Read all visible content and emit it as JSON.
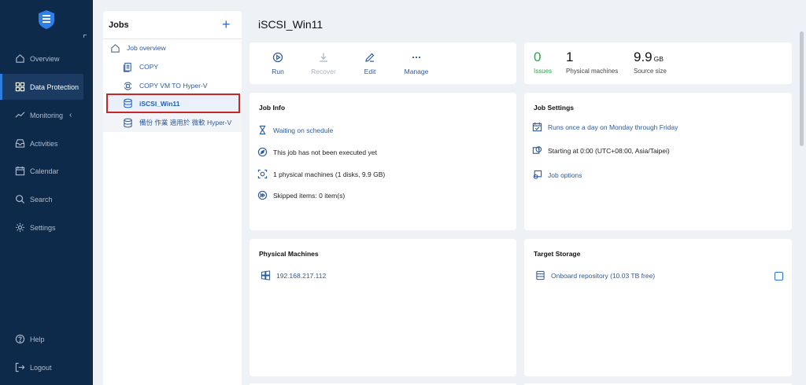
{
  "sidebar": {
    "items": [
      {
        "label": "Overview",
        "icon": "home-icon"
      },
      {
        "label": "Data Protection",
        "icon": "grid-icon",
        "active": true
      },
      {
        "label": "Monitoring",
        "icon": "chart-icon"
      },
      {
        "label": "Activities",
        "icon": "inbox-icon"
      },
      {
        "label": "Calendar",
        "icon": "calendar-icon"
      },
      {
        "label": "Search",
        "icon": "search-icon"
      },
      {
        "label": "Settings",
        "icon": "gear-icon"
      }
    ],
    "help": "Help",
    "logout": "Logout",
    "monitoring_chevron": "‹"
  },
  "jobs": {
    "title": "Jobs",
    "add_symbol": "+",
    "overview_label": "Job overview",
    "items": [
      {
        "label": "COPY"
      },
      {
        "label": "COPY VM TO Hyper-V"
      },
      {
        "label": "iSCSI_Win11",
        "selected": true
      },
      {
        "label": "備份 作業 適用於 微軟 Hyper-V"
      }
    ]
  },
  "main": {
    "title": "iSCSI_Win11",
    "actions": [
      {
        "label": "Run",
        "enabled": true
      },
      {
        "label": "Recover",
        "enabled": false
      },
      {
        "label": "Edit",
        "enabled": true
      },
      {
        "label": "Manage",
        "enabled": true
      }
    ],
    "stats": [
      {
        "value": "0",
        "unit": "",
        "label": "Issues",
        "color": "#22a846"
      },
      {
        "value": "1",
        "unit": "",
        "label": "Physical machines",
        "color": "#111111"
      },
      {
        "value": "9.9",
        "unit": "GB",
        "label": "Source size",
        "color": "#111111"
      }
    ],
    "job_info": {
      "title": "Job Info",
      "rows": [
        {
          "text": "Waiting on schedule",
          "icon": "hourglass-icon"
        },
        {
          "text": "This job has not been executed yet",
          "icon": "compass-icon"
        },
        {
          "text": "1 physical machines (1 disks, 9.9 GB)",
          "icon": "target-icon"
        },
        {
          "text": "Skipped items: 0 item(s)",
          "icon": "skip-icon"
        }
      ]
    },
    "job_settings": {
      "title": "Job Settings",
      "rows": [
        {
          "text": "Runs once a day on Monday through Friday",
          "icon": "calendar-check-icon"
        },
        {
          "text": "Starting at 0:00 (UTC+08:00, Asia/Taipei)",
          "icon": "clock-icon"
        },
        {
          "text": "Job options",
          "icon": "options-icon"
        }
      ]
    },
    "physical_machines": {
      "title": "Physical Machines",
      "items": [
        {
          "text": "192.168.217.112",
          "icon": "windows-icon"
        }
      ]
    },
    "target_storage": {
      "title": "Target Storage",
      "items": [
        {
          "text": "Onboard repository (10.03 TB free)",
          "icon": "storage-icon"
        }
      ]
    }
  },
  "colors": {
    "sidebar_bg": "#0e2a4a",
    "accent": "#2f6fd6",
    "link": "#2d5a99",
    "issues_green": "#22a846",
    "selection_border": "#c62828"
  }
}
